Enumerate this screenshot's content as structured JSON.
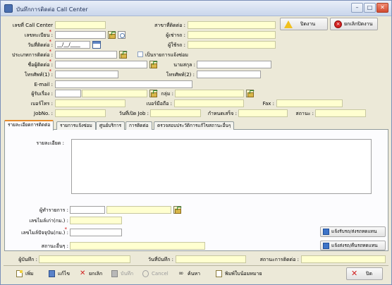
{
  "window": {
    "title": "บันทึกการติดต่อ Call Center",
    "min": "–",
    "max": "□",
    "close": "✕"
  },
  "header": {
    "call_center_no_label": "เลขที่ Call Center",
    "call_center_no_value": "",
    "agent_label": "สาขาที่ติดต่อ :",
    "save_label": "ปิดงาน",
    "cancel_job_label": "ยกเลิกปิดงาน",
    "reg_no_label": "เลขทะเบียน :",
    "tenant_label": "ผู้เช่ารถ :",
    "contact_date_label": "วันที่ติดต่อ :",
    "contact_date_value": "__/__/____",
    "car_user_label": "ผู้ใช้รถ :",
    "contact_type_label": "ประเภทการติดต่อ :",
    "notice_label": "เป็นรายการแจ้งซ่อม",
    "contact_name_label": "ชื่อผู้ติดต่อ :",
    "surname_label": "นามสกุล :",
    "phone1_label": "โทรศัพท์(1) :",
    "phone2_label": "โทรศัพท์(2) :",
    "email_label": "E-mail :",
    "issue_receiver_label": "ผู้รับเรื่อง :",
    "group_label": "กลุ่ม :",
    "mobile_label": "เบอร์โทร :",
    "mobile2_label": "เบอร์มือถือ :",
    "fax_label": "Fax :",
    "jobno_label": "JobNo. :",
    "open_job_label": "วันที่เปิด Job :",
    "due_label": "กำหนดเสร็จ :",
    "status_label": "สถานะ :"
  },
  "tabs": [
    {
      "label": "รายละเอียดการติดต่อ"
    },
    {
      "label": "รายการแจ้งซ่อม"
    },
    {
      "label": "ศูนย์บริการ"
    },
    {
      "label": "การติดต่อ"
    },
    {
      "label": "ตรวจสอบประวัติการแก้ไขสถานะอื่นๆ"
    }
  ],
  "panel": {
    "detail_label": "รายละเอียด :",
    "operator_label": "ผู้ทำรายการ :",
    "old_mileage_label": "เลขไมล์เก่า(กม.) :",
    "current_mileage_label": "เลขไมล์ปัจจุบัน(กม.) :",
    "other_status_label": "สถานะอื่นๆ :",
    "notify_receive_btn": "แจ้งรับรถ/ส่งรถทดแทน",
    "notify_send_btn": "แจ้งส่งรถ/คืนรถทดแทน"
  },
  "footer": {
    "recorder_label": "ผู้บันทึก :",
    "record_date_label": "วันที่บันทึก :",
    "contact_status_label": "สถานะการติดต่อ :"
  },
  "toolbar": {
    "new": "เพิ่ม",
    "edit": "แก้ไข",
    "cancel": "ยกเลิก",
    "save": "บันทึก",
    "cancel_en": "Cancel",
    "find": "ค้นหา",
    "print": "พิมพ์ใบน้อมหมาย",
    "close": "ปิด"
  }
}
